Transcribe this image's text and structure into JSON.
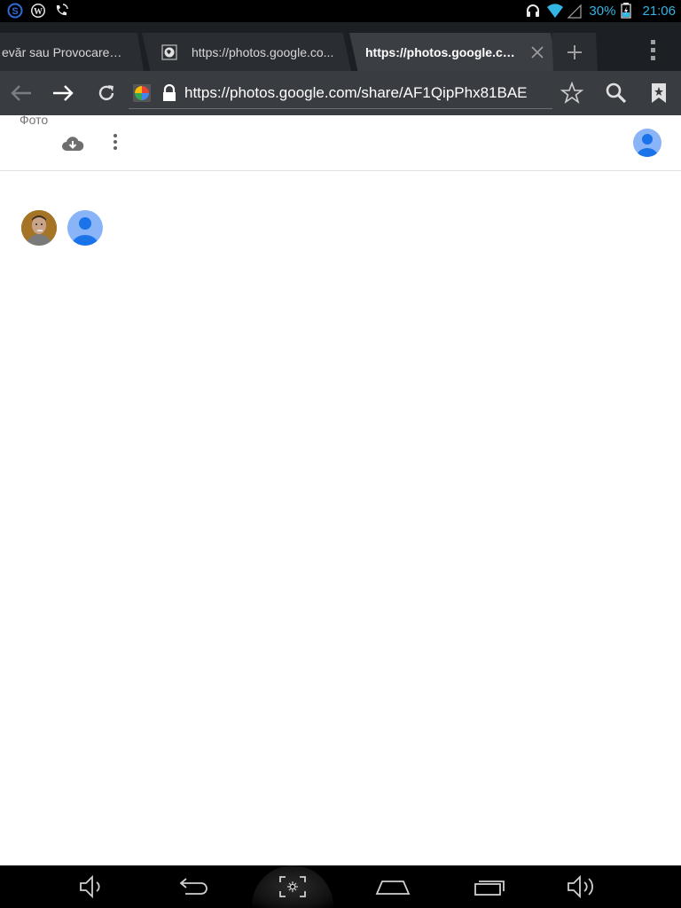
{
  "status_bar": {
    "left_icons": [
      "skype-icon",
      "wordpress-icon",
      "phone-wifi-icon"
    ],
    "right_icons": [
      "headphones-icon",
      "wifi-icon",
      "signal-icon",
      "battery-icon"
    ],
    "battery_percent": "30%",
    "time": "21:06"
  },
  "tabs": [
    {
      "label": "evăr sau Provocare? ::..."
    },
    {
      "label": "https://photos.google.co..."
    },
    {
      "label": "https://photos.google.co...",
      "active": true
    }
  ],
  "toolbar": {
    "url": "https://photos.google.com/share/AF1QipPhx81BAE"
  },
  "page": {
    "title": "Фото"
  },
  "colors": {
    "accent": "#33b5e5",
    "tabstrip": "#1c1f24",
    "toolbar": "#393c41",
    "avatar_blue": "#8ab4f8"
  }
}
